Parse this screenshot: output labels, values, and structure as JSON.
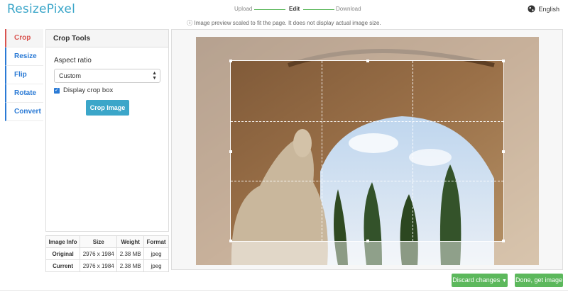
{
  "app": {
    "logo": "ResizePixel"
  },
  "steps": [
    {
      "label": "Upload",
      "active": false
    },
    {
      "label": "Edit",
      "active": true
    },
    {
      "label": "Download",
      "active": false
    }
  ],
  "language": {
    "icon": "globe-icon",
    "label": "English"
  },
  "notice": "ⓘ Image preview scaled to fit the page. It does not display actual image size.",
  "tabs": [
    {
      "label": "Crop",
      "active": true
    },
    {
      "label": "Resize",
      "active": false
    },
    {
      "label": "Flip",
      "active": false
    },
    {
      "label": "Rotate",
      "active": false
    },
    {
      "label": "Convert",
      "active": false
    }
  ],
  "tools": {
    "title": "Crop Tools",
    "aspect_label": "Aspect ratio",
    "aspect_value": "Custom",
    "display_crop_box_label": "Display crop box",
    "display_crop_box_checked": true,
    "crop_button": "Crop Image"
  },
  "info_table": {
    "headers": [
      "Image Info",
      "Size",
      "Weight",
      "Format"
    ],
    "rows": [
      {
        "label": "Original",
        "size": "2976 x 1984",
        "weight": "2.38 MB",
        "format": "jpeg"
      },
      {
        "label": "Current",
        "size": "2976 x 1984",
        "weight": "2.38 MB",
        "format": "jpeg"
      }
    ]
  },
  "actions": {
    "discard": "Discard changes",
    "done": "Done, get image"
  },
  "colors": {
    "brand": "#3ba6c9",
    "active_tab": "#d9534f",
    "link": "#2a7ad5",
    "success": "#5cb85c"
  }
}
